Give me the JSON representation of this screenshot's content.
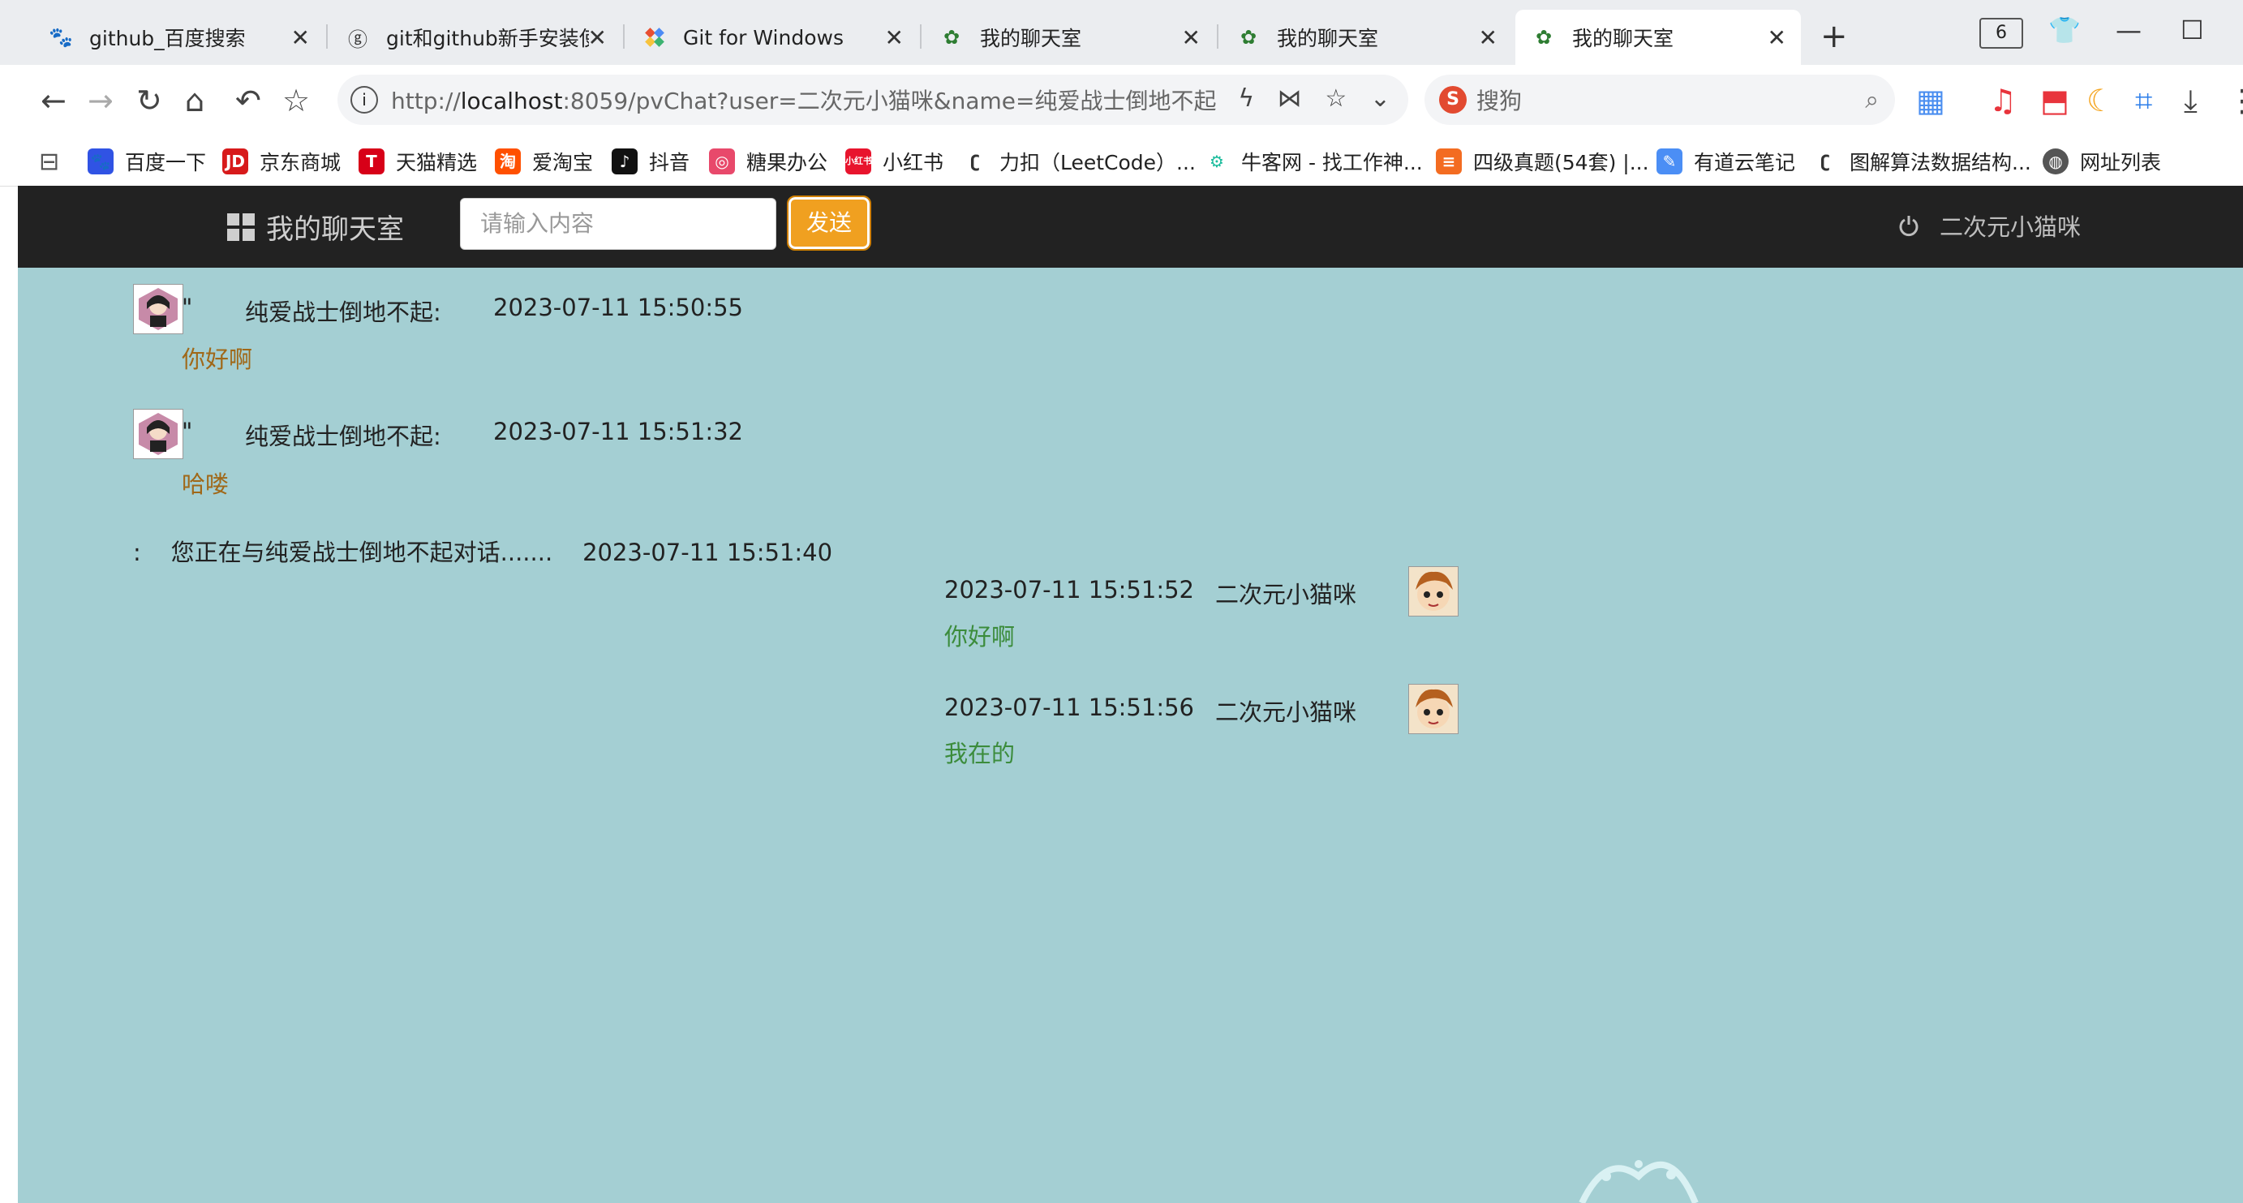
{
  "browser": {
    "tabs": [
      {
        "label": "github_百度搜索",
        "icon": "baidu-paw-icon"
      },
      {
        "label": "git和github新手安装使",
        "icon": "git-icon"
      },
      {
        "label": "Git for Windows",
        "icon": "git-diamond-icon"
      },
      {
        "label": "我的聊天室",
        "icon": "chat-room-icon"
      },
      {
        "label": "我的聊天室",
        "icon": "chat-room-icon"
      },
      {
        "label": "我的聊天室",
        "icon": "chat-room-icon"
      }
    ],
    "tab_count": "6",
    "address": {
      "prefix": "http://",
      "host": "localhost",
      "rest": ":8059/pvChat?user=二次元小猫咪&name=纯爱战士倒地不起"
    },
    "search_engine": "搜狗",
    "bookmarks": [
      {
        "label": "百度一下",
        "color": "#3053e4"
      },
      {
        "label": "京东商城",
        "color": "#d71a1b"
      },
      {
        "label": "天猫精选",
        "color": "#d70018"
      },
      {
        "label": "爱淘宝",
        "color": "#ff5000"
      },
      {
        "label": "抖音",
        "color": "#111111"
      },
      {
        "label": "糖果办公",
        "color": "#e8496b"
      },
      {
        "label": "小红书",
        "color": "#e8142d"
      },
      {
        "label": "力扣（LeetCode）...",
        "color": "#f89f1b"
      },
      {
        "label": "牛客网 - 找工作神...",
        "color": "#1abc9c"
      },
      {
        "label": "四级真题(54套) |...",
        "color": "#f36c21"
      },
      {
        "label": "有道云笔记",
        "color": "#4b8ef5"
      },
      {
        "label": "图解算法数据结构...",
        "color": "#f89f1b"
      },
      {
        "label": "网址列表",
        "color": "#555555"
      }
    ]
  },
  "app": {
    "brand": "我的聊天室",
    "input_placeholder": "请输入内容",
    "send_label": "发送",
    "current_user": "二次元小猫咪"
  },
  "messages": [
    {
      "side": "left",
      "quote": "\"",
      "sender": "纯爱战士倒地不起:",
      "time": "2023-07-11 15:50:55",
      "content": "你好啊"
    },
    {
      "side": "left",
      "quote": "\"",
      "sender": "纯爱战士倒地不起:",
      "time": "2023-07-11 15:51:32",
      "content": "哈喽"
    },
    {
      "side": "system",
      "prefix": ":",
      "text": "您正在与纯爱战士倒地不起对话.......",
      "time": "2023-07-11 15:51:40"
    },
    {
      "side": "right",
      "time": "2023-07-11 15:51:52",
      "sender": "二次元小猫咪",
      "content": "你好啊"
    },
    {
      "side": "right",
      "time": "2023-07-11 15:51:56",
      "sender": "二次元小猫咪",
      "content": "我在的"
    }
  ]
}
